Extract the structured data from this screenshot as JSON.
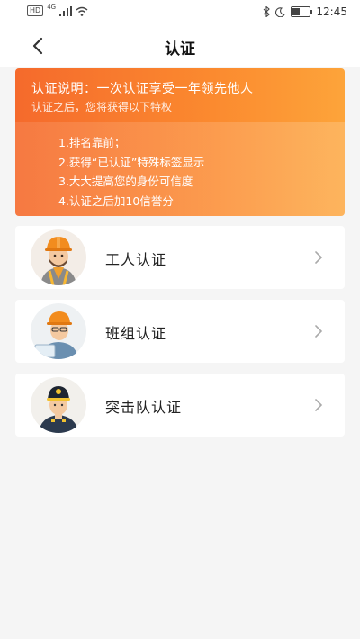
{
  "status_bar": {
    "hd_label": "HD",
    "network_label": "4G",
    "time": "12:45",
    "battery_level": 0.45,
    "icons": [
      "hd-icon",
      "signal-icon",
      "wifi-icon",
      "bluetooth-icon",
      "moon-icon",
      "battery-icon"
    ]
  },
  "nav": {
    "title": "认证",
    "back_icon": "chevron-left-icon"
  },
  "info_card": {
    "title": "认证说明：一次认证享受一年领先他人",
    "subtitle": "认证之后，您将获得以下特权",
    "privileges": [
      "1.排名靠前；",
      "2.获得“已认证”特殊标签显示",
      "3.大大提高您的身份可信度",
      "4.认证之后加10信誉分"
    ],
    "colors": {
      "start": "#f56a2c",
      "end": "#fda43a"
    }
  },
  "cert_options": [
    {
      "label": "工人认证",
      "avatar": "worker-avatar",
      "chevron": "chevron-right-icon"
    },
    {
      "label": "班组认证",
      "avatar": "team-leader-avatar",
      "chevron": "chevron-right-icon"
    },
    {
      "label": "突击队认证",
      "avatar": "commando-avatar",
      "chevron": "chevron-right-icon"
    }
  ]
}
